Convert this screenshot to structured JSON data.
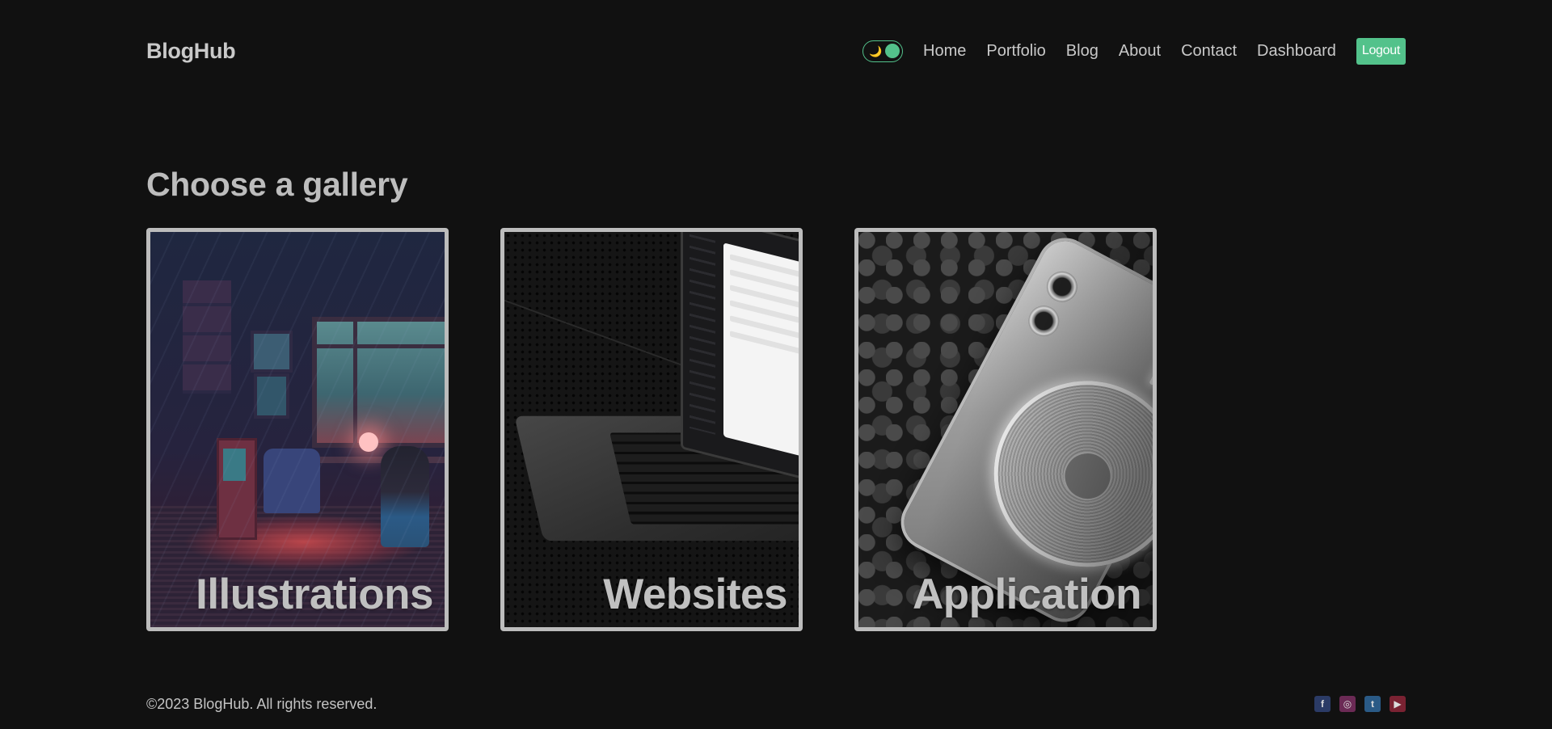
{
  "header": {
    "logo": "BlogHub",
    "theme_toggle": {
      "icon": "moon-icon",
      "glyph": "🌙",
      "accent": "#53c28b"
    },
    "nav": [
      {
        "label": "Home"
      },
      {
        "label": "Portfolio"
      },
      {
        "label": "Blog"
      },
      {
        "label": "About"
      },
      {
        "label": "Contact"
      },
      {
        "label": "Dashboard"
      }
    ],
    "logout_label": "Logout"
  },
  "main": {
    "title": "Choose a gallery",
    "cards": [
      {
        "label": "Illustrations",
        "image": "pixel-art-room-illustration"
      },
      {
        "label": "Websites",
        "image": "laptop-on-perforated-metal"
      },
      {
        "label": "Application",
        "image": "smartphone-on-foam-pieces"
      }
    ]
  },
  "footer": {
    "copyright": "©2023 BlogHub. All rights reserved.",
    "socials": [
      {
        "icon": "facebook-icon",
        "glyph": "f",
        "color": "#2b3b66"
      },
      {
        "icon": "instagram-icon",
        "glyph": "◎",
        "color": "#6b2a55"
      },
      {
        "icon": "twitter-icon",
        "glyph": "t",
        "color": "#2a5a86"
      },
      {
        "icon": "youtube-icon",
        "glyph": "▶",
        "color": "#7a2232"
      }
    ]
  },
  "colors": {
    "background": "#111111",
    "accent": "#53c28b",
    "text": "#c9c9c9"
  }
}
